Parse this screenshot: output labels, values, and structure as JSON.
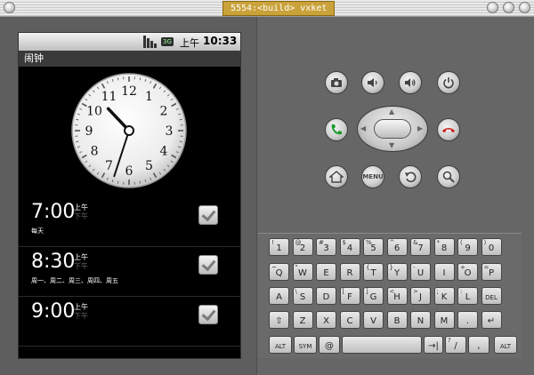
{
  "window": {
    "title": "5554:<build> vxket"
  },
  "status_bar": {
    "ampm": "上午",
    "time": "10:33",
    "network": "3G"
  },
  "app": {
    "title": "闹钟"
  },
  "clock": {
    "numerals": [
      "12",
      "1",
      "2",
      "3",
      "4",
      "5",
      "6",
      "7",
      "8",
      "9",
      "10",
      "11"
    ],
    "hour": 10,
    "minute": 33
  },
  "alarms": [
    {
      "time": "7:00",
      "ampm_active": "上午",
      "ampm_inactive": "下午",
      "days": "每天",
      "enabled": true
    },
    {
      "time": "8:30",
      "ampm_active": "上午",
      "ampm_inactive": "下午",
      "days": "周一、周二、周三、周四、周五",
      "enabled": true
    },
    {
      "time": "9:00",
      "ampm_active": "上午",
      "ampm_inactive": "下午",
      "days": "",
      "enabled": true
    }
  ],
  "hardware_buttons": {
    "row1": [
      "camera-icon",
      "volume-down-icon",
      "volume-up-icon",
      "power-icon"
    ],
    "row3": [
      "home-icon",
      "MENU",
      "back-icon",
      "search-icon"
    ],
    "menu_label": "MENU"
  },
  "keyboard": {
    "row1": [
      {
        "main": "1",
        "alt": "!"
      },
      {
        "main": "2",
        "alt": "@"
      },
      {
        "main": "3",
        "alt": "#"
      },
      {
        "main": "4",
        "alt": "$"
      },
      {
        "main": "5",
        "alt": "%"
      },
      {
        "main": "6",
        "alt": "^"
      },
      {
        "main": "7",
        "alt": "&"
      },
      {
        "main": "8",
        "alt": "*"
      },
      {
        "main": "9",
        "alt": "("
      },
      {
        "main": "0",
        "alt": ")"
      }
    ],
    "row2": [
      {
        "main": "Q",
        "alt": "~"
      },
      {
        "main": "W",
        "alt": "\""
      },
      {
        "main": "E",
        "alt": ""
      },
      {
        "main": "R",
        "alt": ""
      },
      {
        "main": "T",
        "alt": "{"
      },
      {
        "main": "Y",
        "alt": "}"
      },
      {
        "main": "U",
        "alt": "-"
      },
      {
        "main": "I",
        "alt": ""
      },
      {
        "main": "O",
        "alt": "+"
      },
      {
        "main": "P",
        "alt": "="
      }
    ],
    "row3": [
      {
        "main": "A",
        "alt": ""
      },
      {
        "main": "S",
        "alt": "\\"
      },
      {
        "main": "D",
        "alt": ""
      },
      {
        "main": "F",
        "alt": "["
      },
      {
        "main": "G",
        "alt": "]"
      },
      {
        "main": "H",
        "alt": "<"
      },
      {
        "main": "J",
        "alt": ">"
      },
      {
        "main": "K",
        "alt": ";"
      },
      {
        "main": "L",
        "alt": ":"
      },
      {
        "main": "DEL",
        "alt": ""
      }
    ],
    "row4": [
      {
        "main": "⇧",
        "alt": ""
      },
      {
        "main": "Z",
        "alt": ""
      },
      {
        "main": "X",
        "alt": ""
      },
      {
        "main": "C",
        "alt": ""
      },
      {
        "main": "V",
        "alt": ""
      },
      {
        "main": "B",
        "alt": ""
      },
      {
        "main": "N",
        "alt": ""
      },
      {
        "main": "M",
        "alt": ""
      },
      {
        "main": ".",
        "alt": ""
      },
      {
        "main": "↵",
        "alt": ""
      }
    ],
    "row5": [
      {
        "main": "ALT",
        "alt": ""
      },
      {
        "main": "SYM",
        "alt": ""
      },
      {
        "main": "@",
        "alt": ""
      },
      {
        "main": "",
        "alt": ""
      },
      {
        "main": "→|",
        "alt": ""
      },
      {
        "main": "/",
        "alt": "?"
      },
      {
        "main": ",",
        "alt": ""
      },
      {
        "main": "ALT",
        "alt": ""
      }
    ]
  },
  "colors": {
    "call_green": "#1a9a2a",
    "end_red": "#d01818",
    "title_accent": "#caa23a"
  }
}
